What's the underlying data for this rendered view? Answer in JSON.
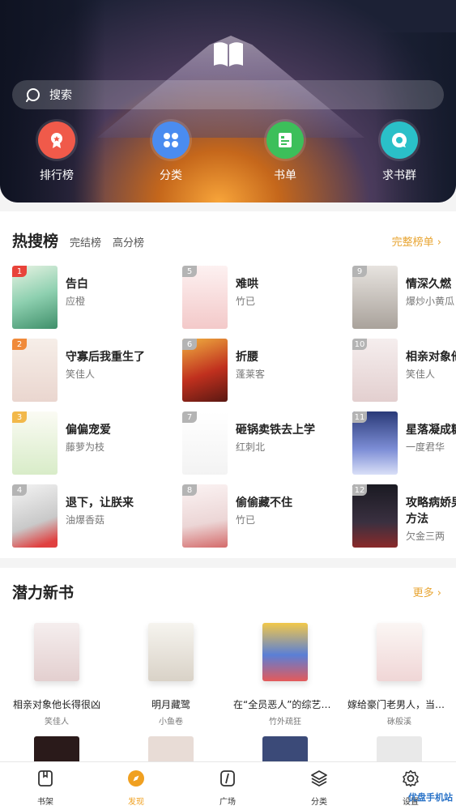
{
  "search": {
    "placeholder": "搜索"
  },
  "shortcuts": [
    {
      "label": "排行榜",
      "icon": "ranking-icon",
      "color": "#f05a4a"
    },
    {
      "label": "分类",
      "icon": "category-icon",
      "color": "#4a8cf0"
    },
    {
      "label": "书单",
      "icon": "booklist-icon",
      "color": "#3cbf5a"
    },
    {
      "label": "求书群",
      "icon": "chat-icon",
      "color": "#2ac0c8"
    }
  ],
  "hot": {
    "title": "热搜榜",
    "tabs": [
      "完结榜",
      "高分榜"
    ],
    "more": "完整榜单",
    "items": [
      {
        "rank": "1",
        "title": "告白",
        "author": "应橙"
      },
      {
        "rank": "2",
        "title": "守寡后我重生了",
        "author": "笑佳人"
      },
      {
        "rank": "3",
        "title": "偏偏宠爱",
        "author": "藤萝为枝"
      },
      {
        "rank": "4",
        "title": "退下，让朕来",
        "author": "油爆香菇"
      },
      {
        "rank": "5",
        "title": "难哄",
        "author": "竹已"
      },
      {
        "rank": "6",
        "title": "折腰",
        "author": "蓬莱客"
      },
      {
        "rank": "7",
        "title": "砸锅卖铁去上学",
        "author": "红刺北"
      },
      {
        "rank": "8",
        "title": "偷偷藏不住",
        "author": "竹已"
      },
      {
        "rank": "9",
        "title": "情深久燃",
        "author": "爆炒小黄瓜"
      },
      {
        "rank": "10",
        "title": "相亲对象他",
        "author": "笑佳人"
      },
      {
        "rank": "11",
        "title": "星落凝成糖",
        "author": "一度君华"
      },
      {
        "rank": "12",
        "title": "攻略病娇男",
        "title2": "方法",
        "author": "欠金三两"
      }
    ]
  },
  "newbooks": {
    "title": "潜力新书",
    "more": "更多",
    "items": [
      {
        "title": "相亲对象他长得很凶",
        "author": "笑佳人"
      },
      {
        "title": "明月藏鹭",
        "author": "小鱼卷"
      },
      {
        "title": "在“全员恶人”的综艺里...",
        "author": "竹外疏狂"
      },
      {
        "title": "嫁给豪门老男人，当总...",
        "author": "砯般溪"
      }
    ]
  },
  "tabbar": [
    {
      "label": "书架",
      "icon": "bookshelf-icon"
    },
    {
      "label": "发现",
      "icon": "discover-icon",
      "active": true
    },
    {
      "label": "广场",
      "icon": "square-icon"
    },
    {
      "label": "分类",
      "icon": "layers-icon"
    },
    {
      "label": "设置",
      "icon": "gear-icon"
    }
  ],
  "watermark": "优盘手机站"
}
